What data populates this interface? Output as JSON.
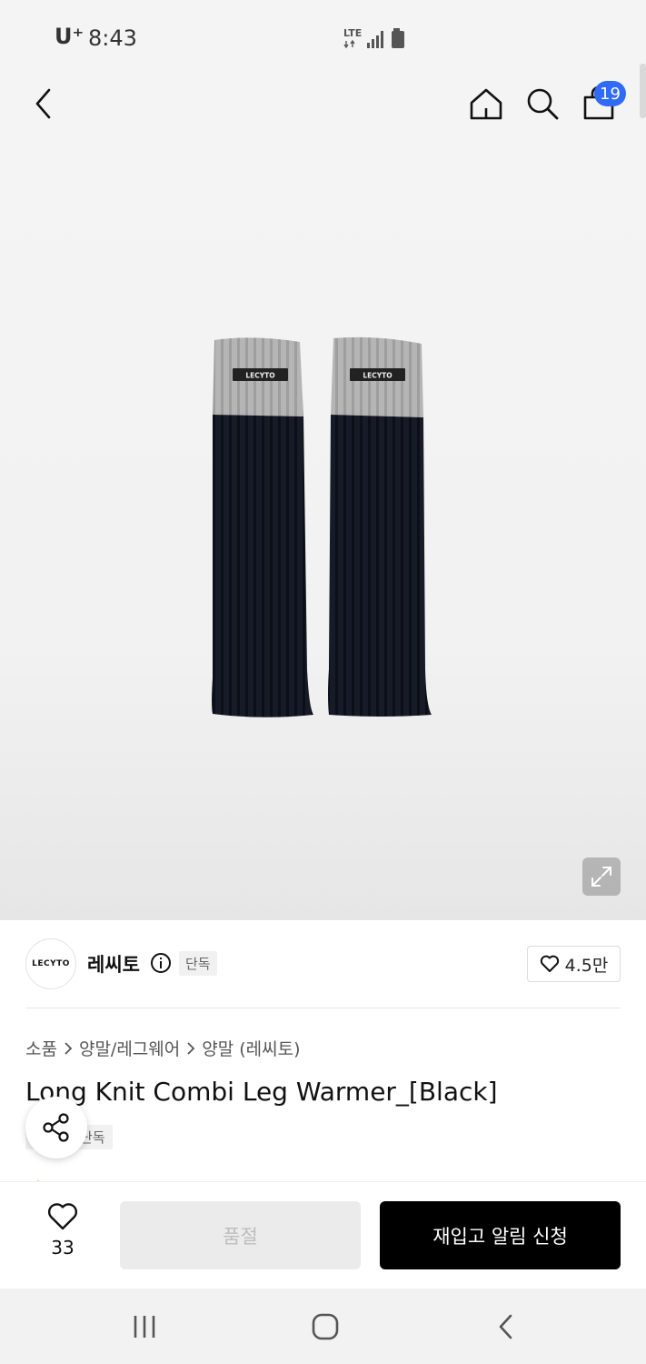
{
  "status_bar": {
    "carrier": "U⁺",
    "time": "8:43",
    "network": "LTE"
  },
  "header": {
    "cart_count": "19"
  },
  "product_image": {
    "label_text": "LECYTO"
  },
  "brand": {
    "logo_text": "LECYTO",
    "name": "레씨토",
    "exclusive_tag": "단독",
    "like_count": "4.5만"
  },
  "breadcrumb": [
    "소품",
    "양말/레그웨어",
    "양말 (레씨토)"
  ],
  "product": {
    "title": "Long Knit Combi Leg Warmer_[Black]",
    "tag": "단독"
  },
  "bottom_bar": {
    "wish_count": "33",
    "soldout_label": "품절",
    "restock_label": "재입고 알림 신청"
  },
  "colors": {
    "accent": "#2f6bf6",
    "knit_gray": "#b4b4b4",
    "knit_black": "#161a26"
  }
}
